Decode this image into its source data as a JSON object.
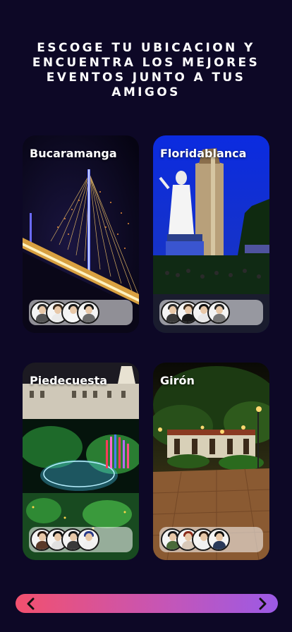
{
  "headline": "ESCOGE TU UBICACION Y ENCUENTRA LOS MEJORES EVENTOS JUNTO A TUS AMIGOS",
  "locations": [
    {
      "name": "Bucaramanga"
    },
    {
      "name": "Floridablanca"
    },
    {
      "name": "Piedecuesta"
    },
    {
      "name": "Girón"
    }
  ],
  "colors": {
    "background": "#0d0826",
    "nav_start": "#f2506e",
    "nav_end": "#9b5ae6"
  },
  "icons": {
    "prev": "chevron-left-icon",
    "next": "chevron-right-icon"
  }
}
